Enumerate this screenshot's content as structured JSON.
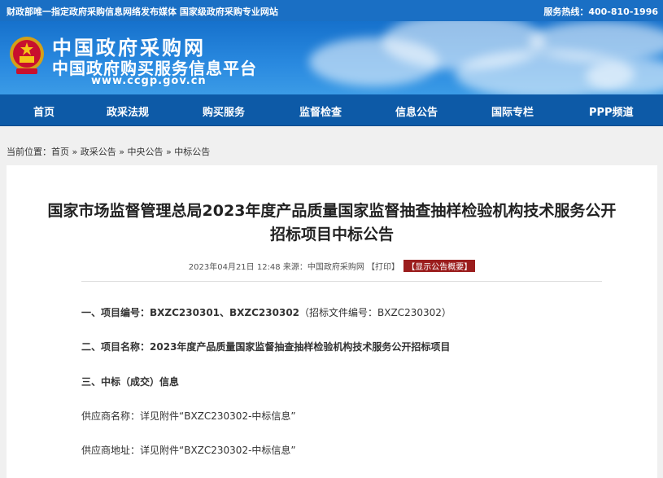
{
  "top_bar": {
    "left_text": "财政部唯一指定政府采购信息网络发布媒体 国家级政府采购专业网站",
    "right_text": "服务热线：400-810-1996"
  },
  "header": {
    "title": "中国政府采购网",
    "subtitle": "中国政府购买服务信息平台",
    "url": "www.ccgp.gov.cn"
  },
  "nav": {
    "items": [
      "首页",
      "政采法规",
      "购买服务",
      "监督检查",
      "信息公告",
      "国际专栏",
      "PPP频道"
    ]
  },
  "breadcrumb": {
    "prefix": "当前位置：",
    "items": [
      "首页",
      "政采公告",
      "中央公告",
      "中标公告"
    ],
    "separator": "»"
  },
  "article": {
    "title_line1": "国家市场监督管理总局2023年度产品质量国家监督抽查抽样检验机构技术服务公开",
    "title_line2": "招标项目中标公告",
    "meta_date": "2023年04月21日 12:48",
    "meta_source": "来源：中国政府采购网",
    "print_label": "【打印】",
    "show_summary_label": "【显示公告概要】",
    "s1_label": "一、项目编号：",
    "s1_value": "BXZC230301、BXZC230302",
    "s1_note": "（招标文件编号：BXZC230302）",
    "s2_label": "二、项目名称：",
    "s2_value": "2023年度产品质量国家监督抽查抽样检验机构技术服务公开招标项目",
    "s3_heading": "三、中标（成交）信息",
    "supplier_name": "供应商名称：详见附件“BXZC230302-中标信息”",
    "supplier_addr": "供应商地址：详见附件“BXZC230302-中标信息”"
  },
  "colors": {
    "top_bar": "#1a6fc4",
    "nav": "#0d5aa7",
    "summary_button": "#9b1d1d"
  },
  "icons": [
    "national-emblem-icon"
  ]
}
